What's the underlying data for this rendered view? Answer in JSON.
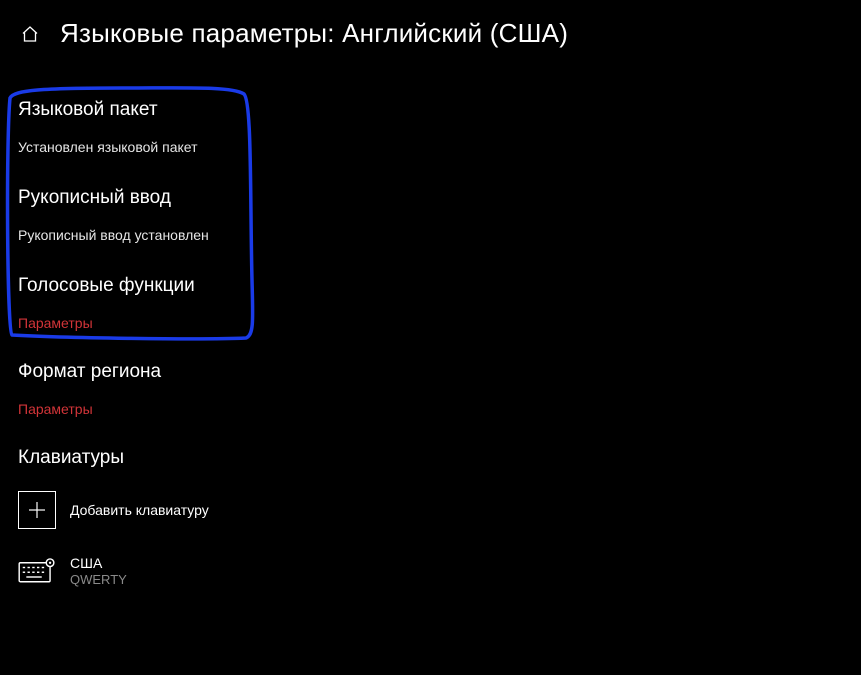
{
  "header": {
    "title": "Языковые параметры: Английский (США)"
  },
  "sections": {
    "language_pack": {
      "heading": "Языковой пакет",
      "status": "Установлен языковой пакет"
    },
    "handwriting": {
      "heading": "Рукописный ввод",
      "status": "Рукописный ввод установлен"
    },
    "speech": {
      "heading": "Голосовые функции",
      "link": "Параметры"
    },
    "region_format": {
      "heading": "Формат региона",
      "link": "Параметры"
    },
    "keyboards": {
      "heading": "Клавиатуры",
      "add_label": "Добавить клавиатуру",
      "items": [
        {
          "name": "США",
          "layout": "QWERTY"
        }
      ]
    }
  }
}
